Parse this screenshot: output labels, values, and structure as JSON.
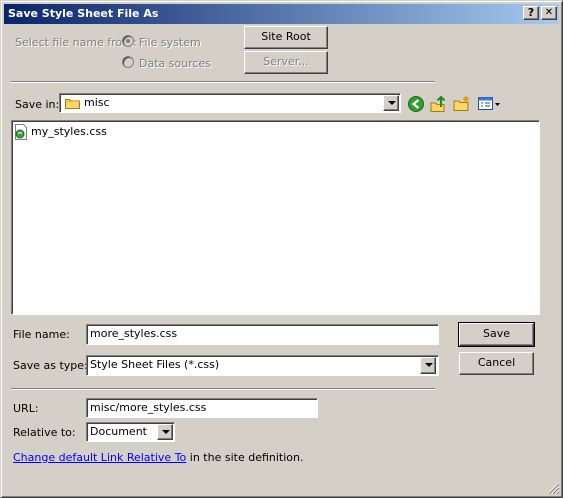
{
  "window": {
    "title": "Save Style Sheet File As",
    "help_label": "?",
    "close_label": "✕"
  },
  "source": {
    "label": "Select file name from:",
    "file_system_label": "File system",
    "data_sources_label": "Data sources",
    "site_root_label": "Site Root",
    "server_label": "Server..."
  },
  "save_in": {
    "label": "Save in:",
    "value": "misc"
  },
  "files": [
    {
      "name": "my_styles.css"
    }
  ],
  "file_name": {
    "label": "File name:",
    "value": "more_styles.css"
  },
  "save_as_type": {
    "label": "Save as type:",
    "value": "Style Sheet Files (*.css)"
  },
  "buttons": {
    "save_label": "Save",
    "cancel_label": "Cancel"
  },
  "url": {
    "label": "URL:",
    "value": "misc/more_styles.css"
  },
  "relative_to": {
    "label": "Relative to:",
    "value": "Document"
  },
  "footer": {
    "link_text": "Change default Link Relative To",
    "suffix_text": " in the site definition."
  },
  "colors": {
    "title_start": "#0a246a",
    "title_end": "#a6caf0",
    "face": "#d4d0c8",
    "link": "#0000ff"
  }
}
